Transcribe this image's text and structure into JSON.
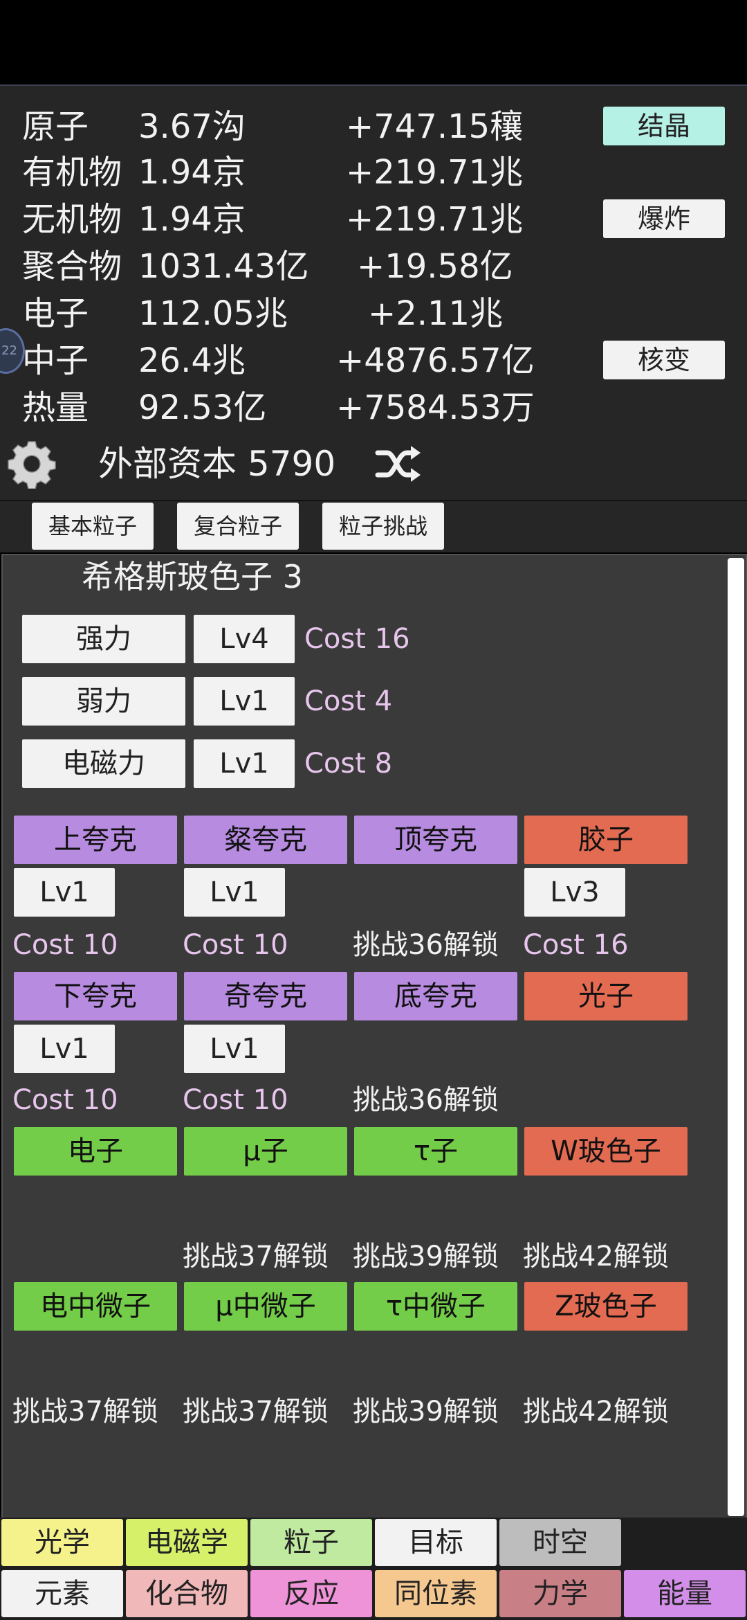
{
  "resources": [
    {
      "name": "原子",
      "value": "3.67沟",
      "rate": "+747.15穰"
    },
    {
      "name": "有机物",
      "value": "1.94京",
      "rate": "+219.71兆"
    },
    {
      "name": "无机物",
      "value": "1.94京",
      "rate": "+219.71兆"
    },
    {
      "name": "聚合物",
      "value": "1031.43亿",
      "rate": "+19.58亿"
    },
    {
      "name": "电子",
      "value": "112.05兆",
      "rate": "+2.11兆"
    },
    {
      "name": "中子",
      "value": "26.4兆",
      "rate": "+4876.57亿"
    },
    {
      "name": "热量",
      "value": "92.53亿",
      "rate": "+7584.53万"
    }
  ],
  "actions": {
    "crystallize": "结晶",
    "explode": "爆炸",
    "fission": "核变"
  },
  "side_badge": "22",
  "capital": "外部资本 5790",
  "tabs": [
    "基本粒子",
    "复合粒子",
    "粒子挑战"
  ],
  "higgs": "希格斯玻色子 3",
  "forces": [
    {
      "name": "强力",
      "level": "Lv4",
      "cost": "Cost 16"
    },
    {
      "name": "弱力",
      "level": "Lv1",
      "cost": "Cost 4"
    },
    {
      "name": "电磁力",
      "level": "Lv1",
      "cost": "Cost 8"
    }
  ],
  "row1": [
    {
      "name": "上夸克",
      "level": "Lv1",
      "info": "Cost 10"
    },
    {
      "name": "粲夸克",
      "level": "Lv1",
      "info": "Cost 10"
    },
    {
      "name": "顶夸克",
      "info": "挑战36解锁"
    },
    {
      "name": "胶子",
      "level": "Lv3",
      "info": "Cost 16"
    }
  ],
  "row2": [
    {
      "name": "下夸克",
      "level": "Lv1",
      "info": "Cost 10"
    },
    {
      "name": "奇夸克",
      "level": "Lv1",
      "info": "Cost 10"
    },
    {
      "name": "底夸克",
      "info": "挑战36解锁"
    },
    {
      "name": "光子"
    }
  ],
  "row3": [
    {
      "name": "电子"
    },
    {
      "name": "μ子",
      "info": "挑战37解锁"
    },
    {
      "name": "τ子",
      "info": "挑战39解锁"
    },
    {
      "name": "W玻色子",
      "info": "挑战42解锁"
    }
  ],
  "row4": [
    {
      "name": "电中微子",
      "info": "挑战37解锁"
    },
    {
      "name": "μ中微子",
      "info": "挑战37解锁"
    },
    {
      "name": "τ中微子",
      "info": "挑战39解锁"
    },
    {
      "name": "Z玻色子",
      "info": "挑战42解锁"
    }
  ],
  "nav": {
    "row1": [
      {
        "label": "光学",
        "color": "#f5f28c"
      },
      {
        "label": "电磁学",
        "color": "#d6f06a"
      },
      {
        "label": "粒子",
        "color": "#bfeaa0"
      },
      {
        "label": "目标",
        "color": "#f2f2f2"
      },
      {
        "label": "时空",
        "color": "#bdbdbd"
      }
    ],
    "row2": [
      {
        "label": "元素",
        "color": "#f2f2f2"
      },
      {
        "label": "化合物",
        "color": "#f0b8b8"
      },
      {
        "label": "反应",
        "color": "#ee93d8"
      },
      {
        "label": "同位素",
        "color": "#f5c890"
      },
      {
        "label": "力学",
        "color": "#c97f86"
      },
      {
        "label": "能量",
        "color": "#d28ee8"
      }
    ]
  }
}
